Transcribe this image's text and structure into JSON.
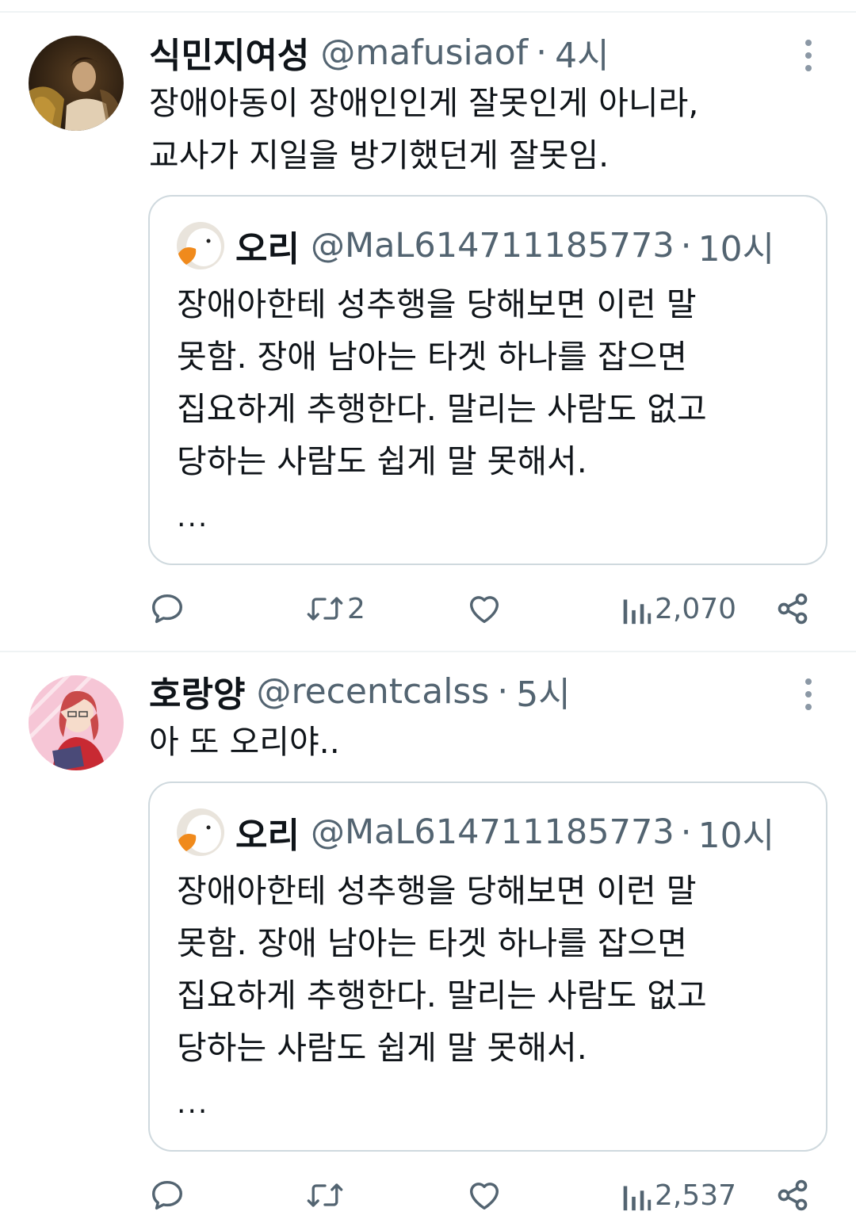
{
  "tweets": [
    {
      "author": {
        "name": "식민지여성",
        "handle": "@mafusiaof",
        "time": "4시",
        "avatar_icon": "painting-portrait-avatar"
      },
      "text_lines": [
        "장애아동이 장애인인게 잘못인게 아니라,",
        "교사가 지일을 방기했던게 잘못임."
      ],
      "quote": {
        "name": "오리",
        "handle": "@MaL614711185773",
        "time": "10시",
        "avatar_icon": "duck-avatar",
        "text_lines": [
          "장애아한테 성추행을 당해보면 이런 말",
          "못함. 장애 남아는 타겟 하나를 잡으면",
          "집요하게 추행한다. 말리는 사람도 없고",
          "당하는 사람도 쉽게 말 못해서."
        ],
        "ellipsis": "..."
      },
      "actions": {
        "reply_count": "",
        "retweet_count": "2",
        "like_count": "",
        "views": "2,070"
      }
    },
    {
      "author": {
        "name": "호랑양",
        "handle": "@recentcalss",
        "time": "5시",
        "avatar_icon": "anime-girl-avatar"
      },
      "text_lines": [
        "아 또 오리야.."
      ],
      "quote": {
        "name": "오리",
        "handle": "@MaL614711185773",
        "time": "10시",
        "avatar_icon": "duck-avatar",
        "text_lines": [
          "장애아한테 성추행을 당해보면 이런 말",
          "못함. 장애 남아는 타겟 하나를 잡으면",
          "집요하게 추행한다. 말리는 사람도 없고",
          "당하는 사람도 쉽게 말 못해서."
        ],
        "ellipsis": "..."
      },
      "actions": {
        "reply_count": "",
        "retweet_count": "",
        "like_count": "",
        "views": "2,537"
      }
    }
  ],
  "colors": {
    "text_primary": "#0f1419",
    "text_secondary": "#536471",
    "border": "#cfd9de",
    "divider": "#eff3f4"
  },
  "separator": "·"
}
